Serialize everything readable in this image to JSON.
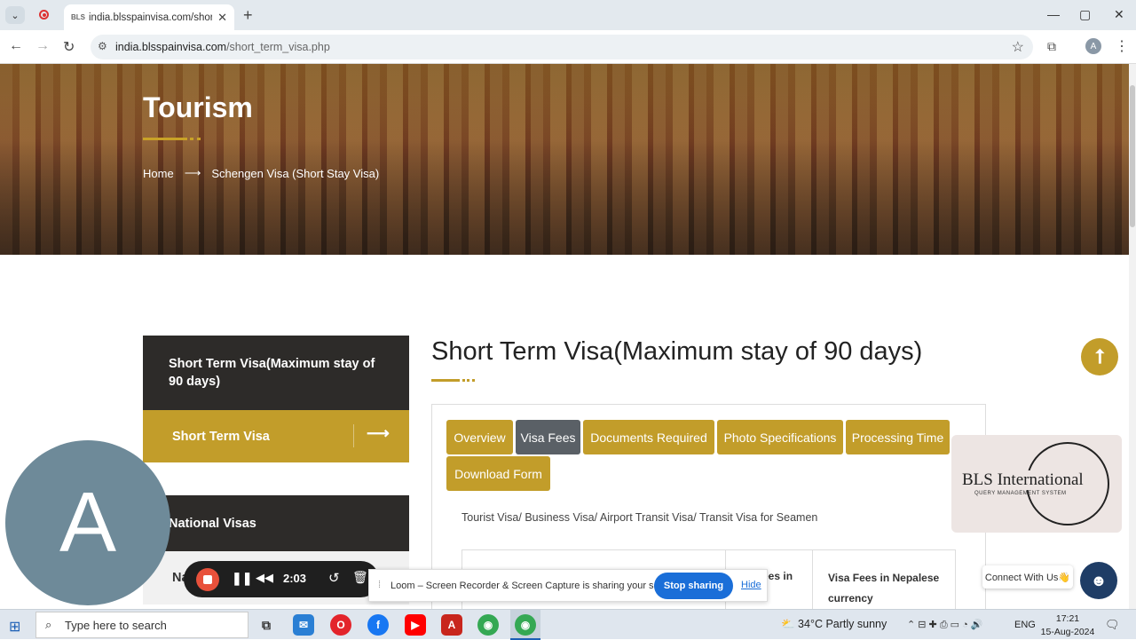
{
  "browser": {
    "tab_title": "india.blsspainvisa.com/short_te",
    "tab_favicon": "BLS",
    "url_domain": "india.blsspainvisa.com",
    "url_path": "/short_term_visa.php",
    "profile_initial": "A"
  },
  "hero": {
    "title": "Tourism",
    "breadcrumb_home": "Home",
    "breadcrumb_arrow": "⟶",
    "breadcrumb_current": "Schengen Visa (Short Stay Visa)"
  },
  "sidebar": {
    "header": "Short Term Visa(Maximum stay of 90 days)",
    "active_item": "Short Term Visa",
    "active_arrow": "⟶",
    "national_header": "National Visas",
    "national_item": "Na"
  },
  "main": {
    "title": "Short Term Visa(Maximum stay of 90 days)",
    "tabs": [
      {
        "label": "Overview",
        "active": false
      },
      {
        "label": "Visa Fees",
        "active": true
      },
      {
        "label": "Documents Required",
        "active": false
      },
      {
        "label": "Photo Specifications",
        "active": false
      },
      {
        "label": "Processing Time",
        "active": false
      },
      {
        "label": "Download Form",
        "active": false
      }
    ],
    "visa_types": "Tourist Visa/ Business Visa/ Airport Transit Visa/ Transit Visa for Seamen",
    "table_header_partial": "ees in",
    "table_header_nepal": "Visa Fees in Nepalese currency"
  },
  "widgets": {
    "bls_logo_name": "BLS International",
    "bls_logo_sub": "QUERY MANAGEMENT SYSTEM",
    "connect_label": "Connect With Us👋",
    "avatar_letter": "A"
  },
  "loom": {
    "time": "2:03",
    "share_message": "Loom – Screen Recorder & Screen Capture is sharing your screen.",
    "stop_label": "Stop sharing",
    "hide_label": "Hide"
  },
  "taskbar": {
    "search_placeholder": "Type here to search",
    "weather": "34°C  Partly sunny",
    "lang": "ENG",
    "time": "17:21",
    "date": "15-Aug-2024"
  },
  "colors": {
    "accent_gold": "#c29d2a",
    "dark_panel": "#2d2b29",
    "active_tab": "#5a6066"
  }
}
